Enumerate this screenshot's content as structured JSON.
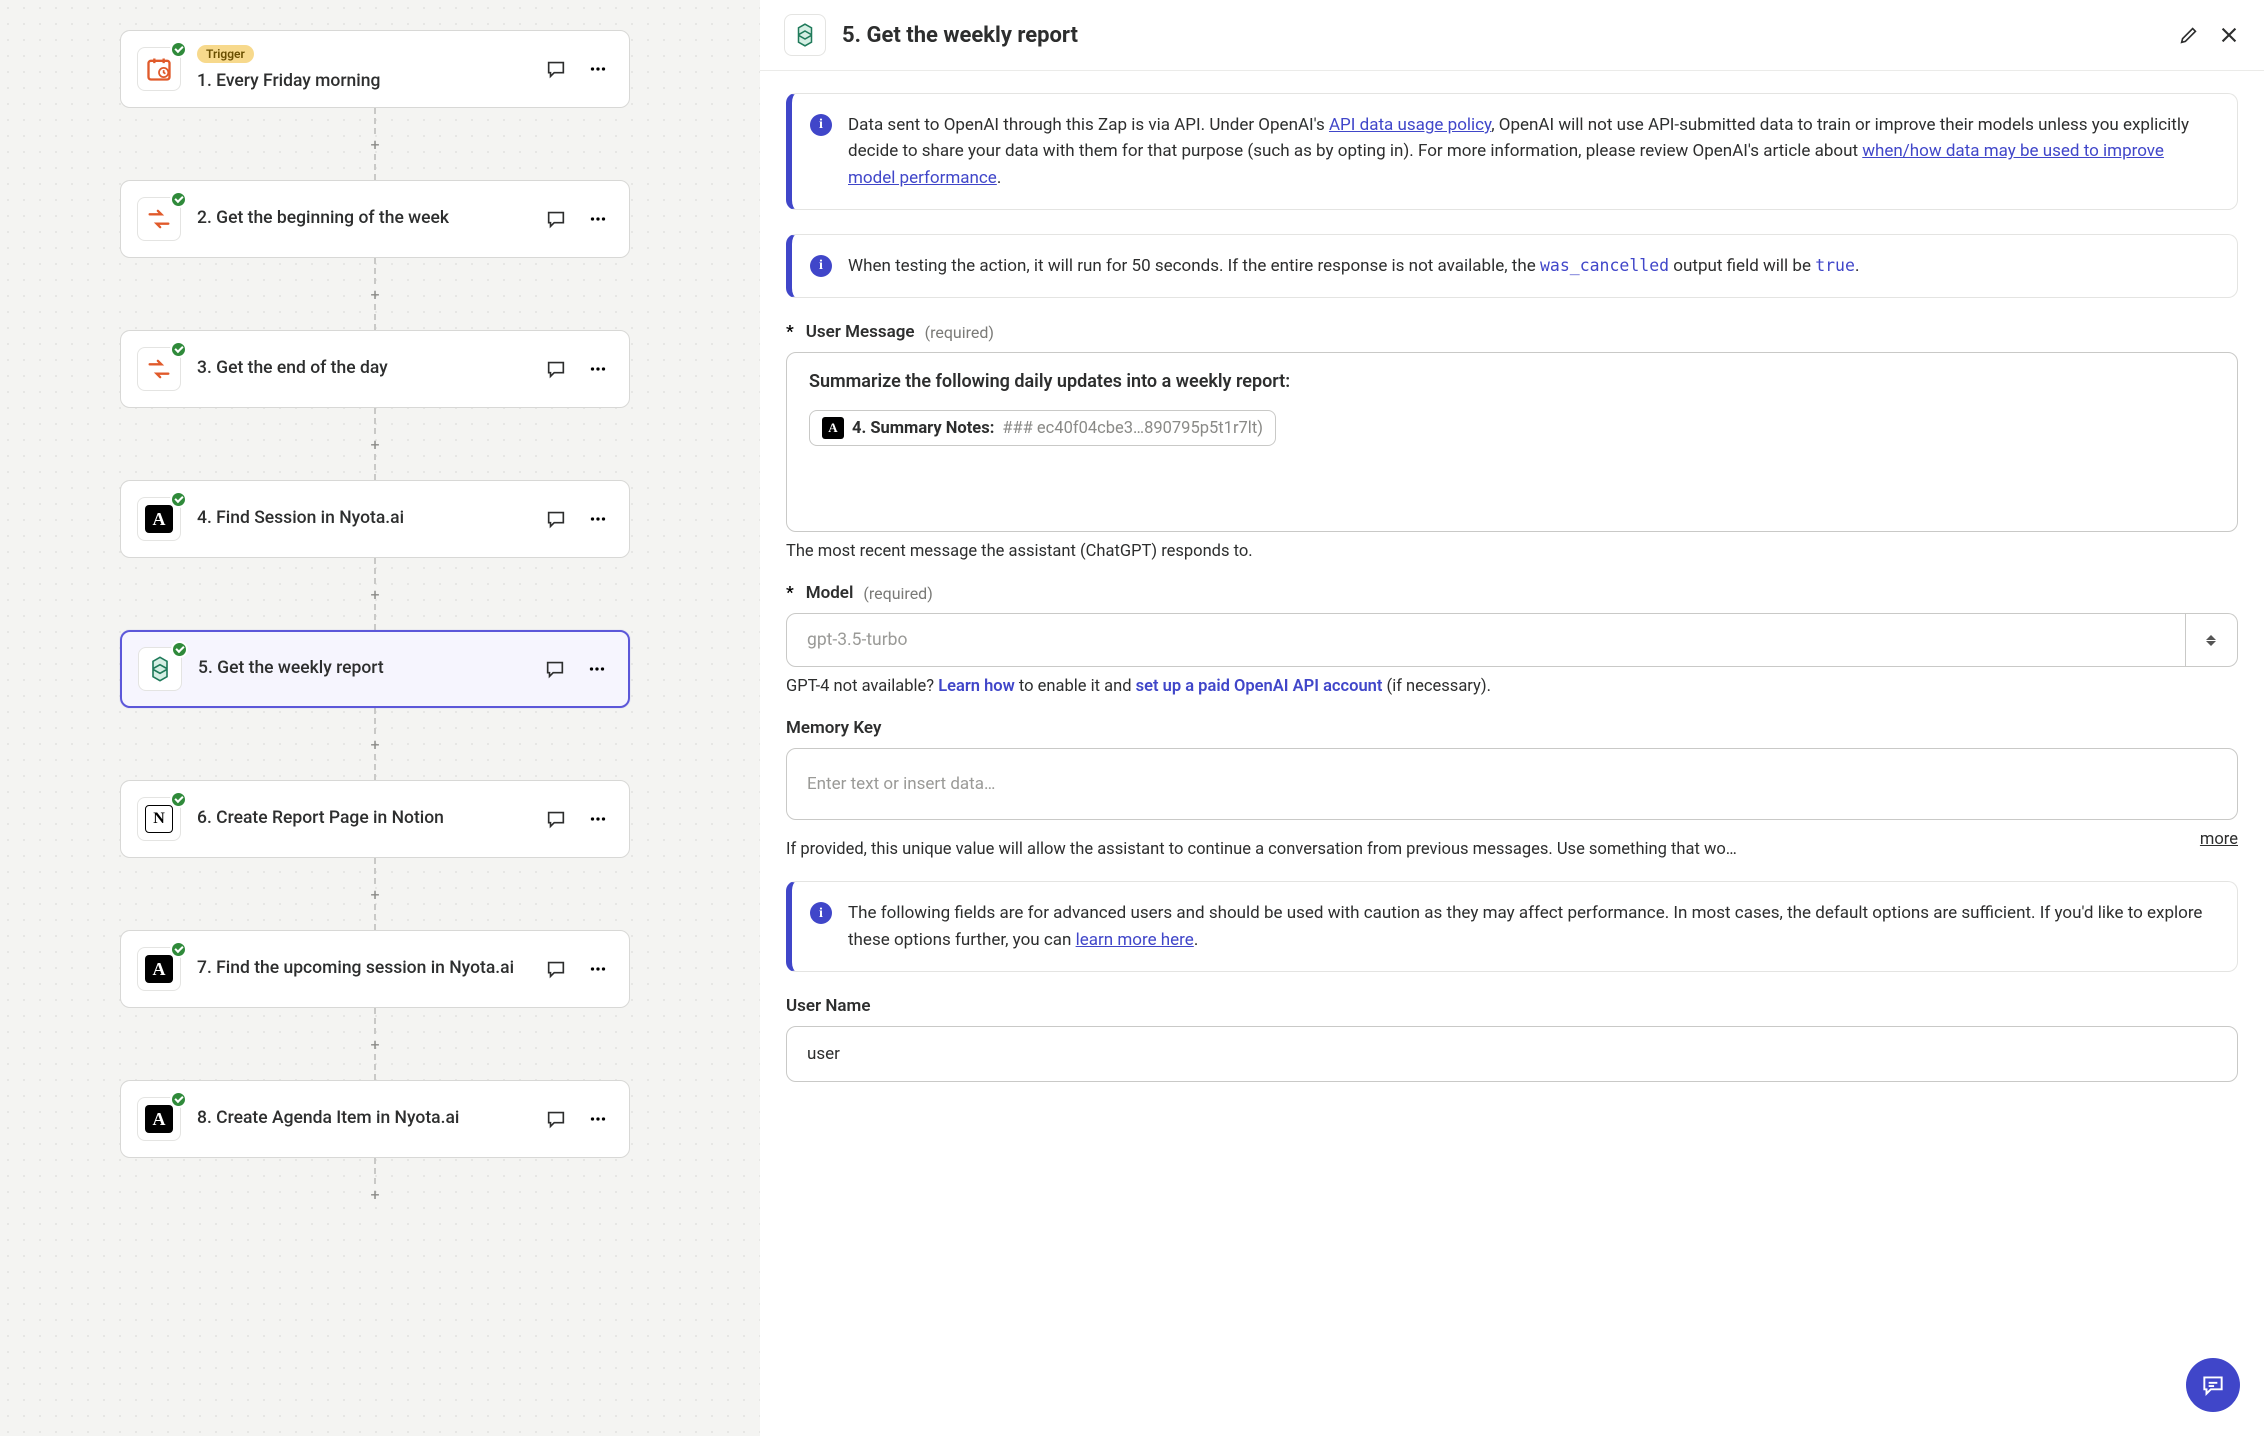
{
  "flow": {
    "trigger_pill": "Trigger",
    "steps": [
      {
        "title": "1. Every Friday morning",
        "icon": "schedule",
        "trigger": true
      },
      {
        "title": "2. Get the beginning of the week",
        "icon": "formatter"
      },
      {
        "title": "3. Get the end of the day",
        "icon": "formatter"
      },
      {
        "title": "4. Find Session in Nyota.ai",
        "icon": "nyota"
      },
      {
        "title": "5. Get the weekly report",
        "icon": "openai",
        "selected": true
      },
      {
        "title": "6. Create Report Page in Notion",
        "icon": "notion"
      },
      {
        "title": "7. Find the upcoming session in Nyota.ai",
        "icon": "nyota"
      },
      {
        "title": "8. Create Agenda Item in Nyota.ai",
        "icon": "nyota"
      }
    ]
  },
  "panel": {
    "title": "5. Get the weekly report",
    "info1": {
      "pre": "Data sent to OpenAI through this Zap is via API. Under OpenAI's ",
      "link1": "API data usage policy",
      "mid": ", OpenAI will not use API-submitted data to train or improve their models unless you explicitly decide to share your data with them for that purpose (such as by opting in). For more information, please review OpenAI's article about ",
      "link2": "when/how data may be used to improve model performance",
      "post": "."
    },
    "info2": {
      "pre": "When testing the action, it will run for 50 seconds. If the entire response is not available, the ",
      "code1": "was_cancelled",
      "mid": " output field will be ",
      "code2": "true",
      "post": "."
    },
    "user_message": {
      "label": "User Message",
      "required": "(required)",
      "text": "Summarize the following daily updates into a weekly report:",
      "pill_label": "4. Summary Notes:",
      "pill_value": "### ec40f04cbe3…890795p5t1r7lt)",
      "help": "The most recent message the assistant (ChatGPT) responds to."
    },
    "model": {
      "label": "Model",
      "required": "(required)",
      "placeholder": "gpt-3.5-turbo",
      "help_pre": "GPT-4 not available? ",
      "help_link1": "Learn how",
      "help_mid": " to enable it and ",
      "help_link2": "set up a paid OpenAI API account",
      "help_post": " (if necessary)."
    },
    "memory": {
      "label": "Memory Key",
      "placeholder": "Enter text or insert data…",
      "help": "If provided, this unique value will allow the assistant to continue a conversation from previous messages. Use something that wo…",
      "more": "more"
    },
    "info3": {
      "pre": "The following fields are for advanced users and should be used with caution as they may affect performance. In most cases, the default options are sufficient. If you'd like to explore these options further, you can ",
      "link": "learn more here",
      "post": "."
    },
    "username": {
      "label": "User Name",
      "value": "user"
    }
  }
}
